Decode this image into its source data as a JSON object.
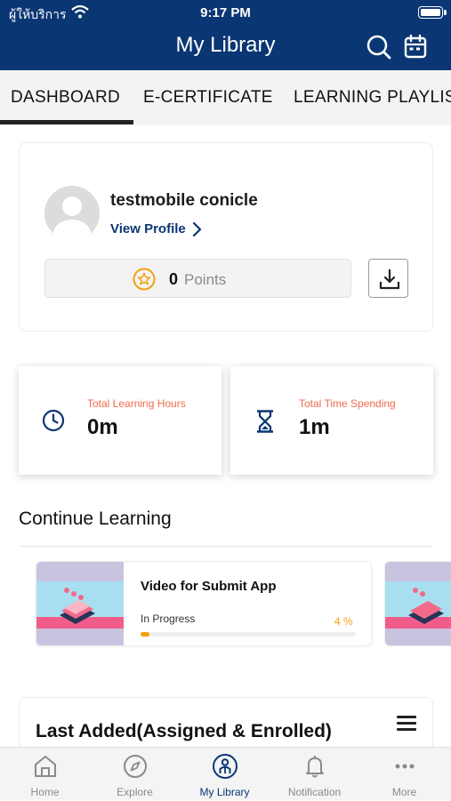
{
  "status_bar": {
    "carrier": "ผู้ให้บริการ",
    "time": "9:17 PM"
  },
  "header": {
    "title": "My Library",
    "search_icon": "search-icon",
    "calendar_icon": "calendar-icon",
    "background": "#0a3673"
  },
  "tabs": [
    {
      "label": "DASHBOARD",
      "active": true
    },
    {
      "label": "E-CERTIFICATE",
      "active": false
    },
    {
      "label": "LEARNING PLAYLIST",
      "active": false
    }
  ],
  "profile": {
    "name": "testmobile conicle",
    "view_profile": "View Profile",
    "points_value": "0",
    "points_label": "Points"
  },
  "stats": [
    {
      "label": "Total Learning Hours",
      "value": "0m",
      "icon": "clock-icon"
    },
    {
      "label": "Total Time Spending",
      "value": "1m",
      "icon": "hourglass-icon"
    }
  ],
  "continue_learning": {
    "title": "Continue Learning",
    "courses": [
      {
        "title": "Video for Submit App",
        "status": "In Progress",
        "progress_label": "4 %",
        "progress": 0.04
      }
    ]
  },
  "last_added": {
    "title": "Last Added(Assigned & Enrolled)"
  },
  "bottom_nav": [
    {
      "label": "Home",
      "icon": "home-icon"
    },
    {
      "label": "Explore",
      "icon": "compass-icon"
    },
    {
      "label": "My Library",
      "icon": "library-icon",
      "active": true
    },
    {
      "label": "Notification",
      "icon": "bell-icon"
    },
    {
      "label": "More",
      "icon": "more-icon"
    }
  ],
  "colors": {
    "accent": "#0a3673",
    "stat_label": "#ef6a4d",
    "progress": "#f2a20c"
  }
}
